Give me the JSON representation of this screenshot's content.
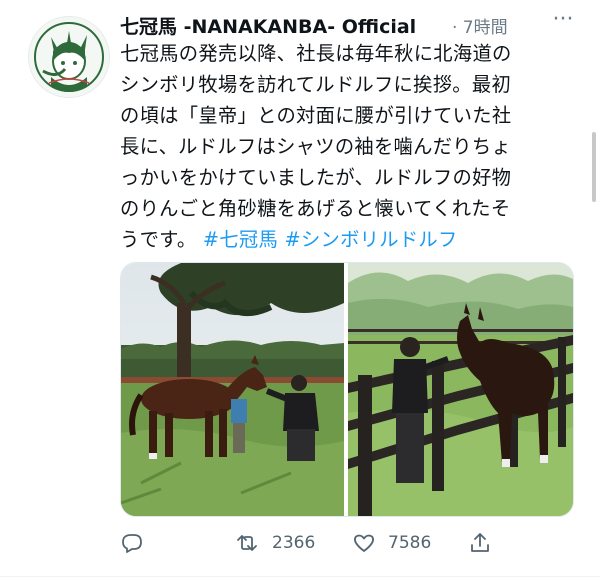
{
  "tweet": {
    "author_name": "七冠馬 -NANAKANBA- Official",
    "time": "· 7時間",
    "more_label": "···",
    "text_lines": [
      "七冠馬の発売以降、社長は毎年秋に北海道の",
      "シンボリ牧場を訪れてルドルフに挨拶。最初",
      "の頃は「皇帝」との対面に腰が引けていた社",
      "長に、ルドルフはシャツの袖を噛んだりちょ",
      "っかいをかけていましたが、ルドルフの好物",
      "のりんごと角砂糖をあげると懐いてくれたそ"
    ],
    "last_line_text": "うです。",
    "hashtags": [
      "#七冠馬",
      "#シンボリルドルフ"
    ]
  },
  "actions": {
    "reply_icon": "reply-icon",
    "retweet_icon": "retweet-icon",
    "retweet_count": "2366",
    "like_icon": "heart-icon",
    "like_count": "7586",
    "share_icon": "share-icon"
  },
  "colors": {
    "hashtag": "#1d9bf0",
    "secondary_text": "#536471",
    "avatar_green": "#2f6b3a"
  }
}
